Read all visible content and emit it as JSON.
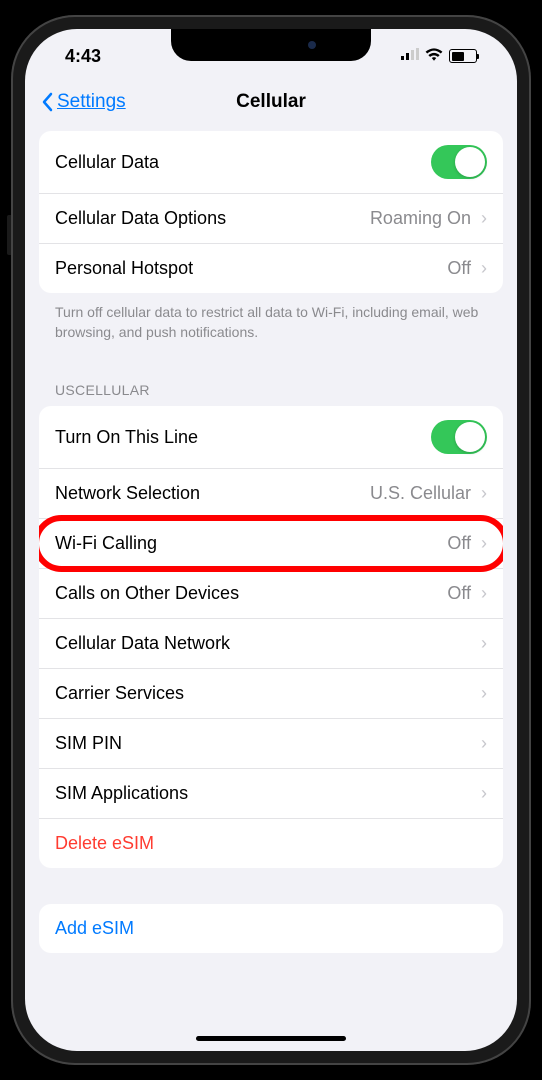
{
  "status": {
    "time": "4:43"
  },
  "nav": {
    "back": "Settings",
    "title": "Cellular"
  },
  "group1": {
    "cellular_data": "Cellular Data",
    "cellular_options": "Cellular Data Options",
    "cellular_options_value": "Roaming On",
    "hotspot": "Personal Hotspot",
    "hotspot_value": "Off"
  },
  "group1_footer": "Turn off cellular data to restrict all data to Wi-Fi, including email, web browsing, and push notifications.",
  "section2_header": "USCELLULAR",
  "group2": {
    "turn_on": "Turn On This Line",
    "network_selection": "Network Selection",
    "network_selection_value": "U.S. Cellular",
    "wifi_calling": "Wi-Fi Calling",
    "wifi_calling_value": "Off",
    "calls_other": "Calls on Other Devices",
    "calls_other_value": "Off",
    "data_network": "Cellular Data Network",
    "carrier_services": "Carrier Services",
    "sim_pin": "SIM PIN",
    "sim_apps": "SIM Applications",
    "delete_esim": "Delete eSIM"
  },
  "group3": {
    "add_esim": "Add eSIM"
  },
  "highlight": {
    "target": "wifi_calling"
  }
}
